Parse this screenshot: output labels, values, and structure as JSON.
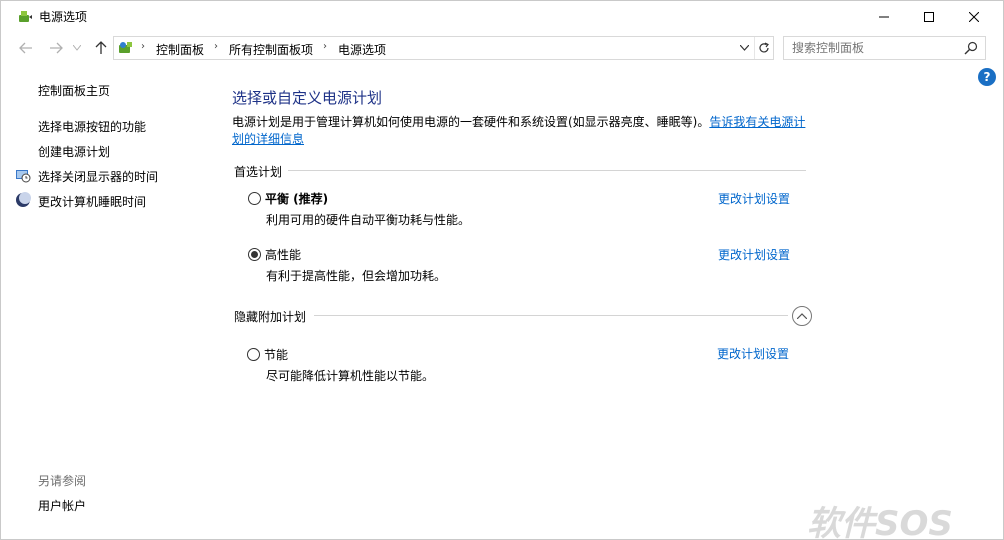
{
  "window": {
    "title": "电源选项"
  },
  "nav": {
    "breadcrumbs": [
      "控制面板",
      "所有控制面板项",
      "电源选项"
    ],
    "search_placeholder": "搜索控制面板"
  },
  "sidebar": {
    "links": [
      {
        "label": "控制面板主页"
      },
      {
        "label": "选择电源按钮的功能"
      },
      {
        "label": "创建电源计划"
      },
      {
        "label": "选择关闭显示器的时间",
        "icon": "monitor-clock-icon"
      },
      {
        "label": "更改计算机睡眠时间",
        "icon": "moon-sleep-icon"
      }
    ],
    "see_also_label": "另请参阅",
    "see_also_links": [
      {
        "label": "用户帐户"
      }
    ]
  },
  "main": {
    "title": "选择或自定义电源计划",
    "description": "电源计划是用于管理计算机如何使用电源的一套硬件和系统设置(如显示器亮度、睡眠等)。",
    "description_link": "告诉我有关电源计划的详细信息",
    "preferred_header": "首选计划",
    "hidden_header": "隐藏附加计划",
    "plans": [
      {
        "name": "平衡 (推荐)",
        "desc": "利用可用的硬件自动平衡功耗与性能。",
        "link": "更改计划设置",
        "selected": false
      },
      {
        "name": "高性能",
        "desc": "有利于提高性能，但会增加功耗。",
        "link": "更改计划设置",
        "selected": true
      }
    ],
    "hidden_plans": [
      {
        "name": "节能",
        "desc": "尽可能降低计算机性能以节能。",
        "link": "更改计划设置",
        "selected": false
      }
    ]
  },
  "watermark": "软件SOS",
  "colors": {
    "title_blue": "#1e3287",
    "link_blue": "#0066cc",
    "help_blue": "#1a6fc4"
  }
}
